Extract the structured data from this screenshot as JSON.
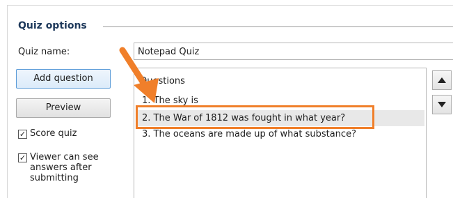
{
  "group": {
    "title": "Quiz options"
  },
  "quiz_name": {
    "label": "Quiz name:",
    "value": "Notepad Quiz"
  },
  "buttons": {
    "add_question": "Add question",
    "preview": "Preview"
  },
  "checkboxes": {
    "score_quiz": {
      "label": "Score quiz",
      "checked": true
    },
    "viewer_answers": {
      "label_lines": [
        "Viewer can see",
        "answers after",
        "submitting"
      ],
      "checked": true
    }
  },
  "questions": {
    "header": "Questions",
    "items": [
      "1. The sky is",
      "2. The War of 1812 was fought in what year?",
      "3. The oceans are made up of what substance?"
    ],
    "selected_index": 1
  },
  "icons": {
    "move_up": "triangle-up-icon",
    "move_down": "triangle-down-icon",
    "callout": "orange-arrow-icon"
  },
  "colors": {
    "highlight": "#f07f2a",
    "selected_row": "#e8e8e8",
    "title": "#1e395b"
  }
}
